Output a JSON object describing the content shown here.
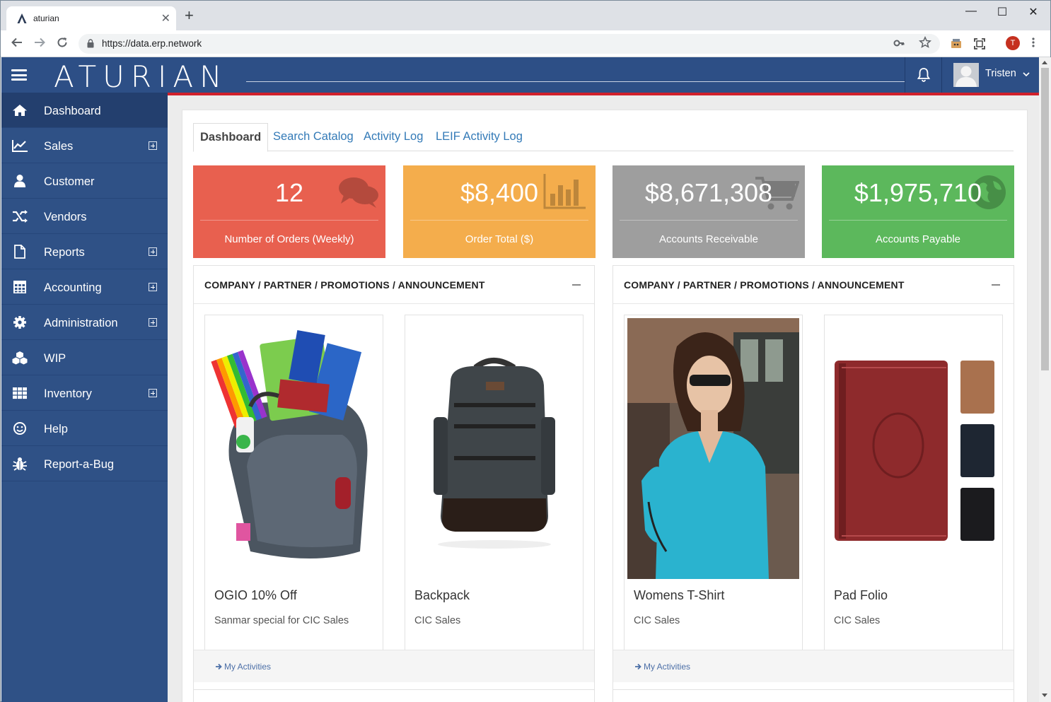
{
  "browser": {
    "tab_title": "aturian",
    "tab_close": "✕",
    "new_tab": "+",
    "url": "https://data.erp.network",
    "profile_initial": "T",
    "win_min": "—",
    "win_max": "☐",
    "win_close": "✕"
  },
  "app": {
    "logo": "ATURIAN",
    "user_name": "Tristen"
  },
  "sidebar": {
    "items": [
      {
        "label": "Dashboard",
        "icon": "home-icon",
        "expandable": false,
        "active": true
      },
      {
        "label": "Sales",
        "icon": "line-chart-icon",
        "expandable": true
      },
      {
        "label": "Customer",
        "icon": "user-icon",
        "expandable": false
      },
      {
        "label": "Vendors",
        "icon": "shuffle-icon",
        "expandable": false
      },
      {
        "label": "Reports",
        "icon": "file-icon",
        "expandable": true
      },
      {
        "label": "Accounting",
        "icon": "calculator-icon",
        "expandable": true
      },
      {
        "label": "Administration",
        "icon": "gear-icon",
        "expandable": true
      },
      {
        "label": "WIP",
        "icon": "cubes-icon",
        "expandable": false
      },
      {
        "label": "Inventory",
        "icon": "grid-icon",
        "expandable": true
      },
      {
        "label": "Help",
        "icon": "smile-icon",
        "expandable": false
      },
      {
        "label": "Report-a-Bug",
        "icon": "bug-icon",
        "expandable": false
      }
    ]
  },
  "tabs": [
    "Dashboard",
    "Search Catalog",
    "Activity Log",
    "LEIF Activity Log"
  ],
  "stats": [
    {
      "value": "12",
      "caption": "Number of Orders (Weekly)",
      "color": "#e8604f",
      "icon": "comments-icon"
    },
    {
      "value": "$8,400",
      "caption": "Order Total ($)",
      "color": "#f4ad4c",
      "icon": "bar-chart-icon"
    },
    {
      "value": "$8,671,308",
      "caption": "Accounts Receivable",
      "color": "#9e9e9e",
      "icon": "cart-icon"
    },
    {
      "value": "$1,975,710",
      "caption": "Accounts Payable",
      "color": "#5cb85c",
      "icon": "globe-icon"
    }
  ],
  "announcements": [
    {
      "title": "COMPANY / PARTNER / PROMOTIONS / ANNOUNCEMENT",
      "cards": [
        {
          "title": "OGIO 10% Off",
          "subtitle": "Sanmar special for CIC Sales"
        },
        {
          "title": "Backpack",
          "subtitle": "CIC Sales"
        }
      ],
      "footer_link": "My Activities"
    },
    {
      "title": "COMPANY / PARTNER / PROMOTIONS / ANNOUNCEMENT",
      "cards": [
        {
          "title": "Womens T-Shirt",
          "subtitle": "CIC Sales"
        },
        {
          "title": "Pad Folio",
          "subtitle": "CIC Sales"
        }
      ],
      "footer_link": "My Activities"
    }
  ]
}
